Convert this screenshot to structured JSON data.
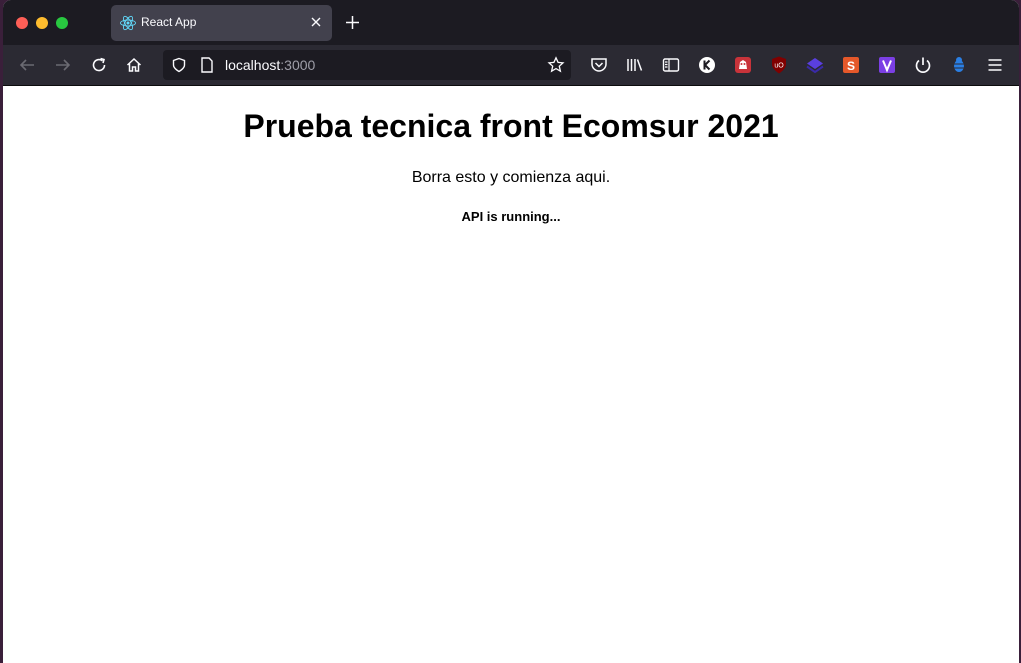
{
  "browser": {
    "tab": {
      "title": "React App",
      "favicon": "react-icon"
    },
    "url": {
      "host": "localhost",
      "port": ":3000"
    },
    "toolbar_icons": [
      "pocket-icon",
      "library-icon",
      "sidebar-icon",
      "k-extension-icon",
      "extension-icon",
      "ublock-icon",
      "extension-layers-icon",
      "extension-s-icon",
      "extension-v-icon",
      "power-icon",
      "extension-bug-icon",
      "menu-icon"
    ]
  },
  "page": {
    "heading": "Prueba tecnica front Ecomsur 2021",
    "paragraph": "Borra esto y comienza aqui.",
    "status": "API is running..."
  },
  "colors": {
    "titlebar": "#1c1b22",
    "navbar": "#2b2a33",
    "tab": "#42414d",
    "react": "#61dafb"
  }
}
